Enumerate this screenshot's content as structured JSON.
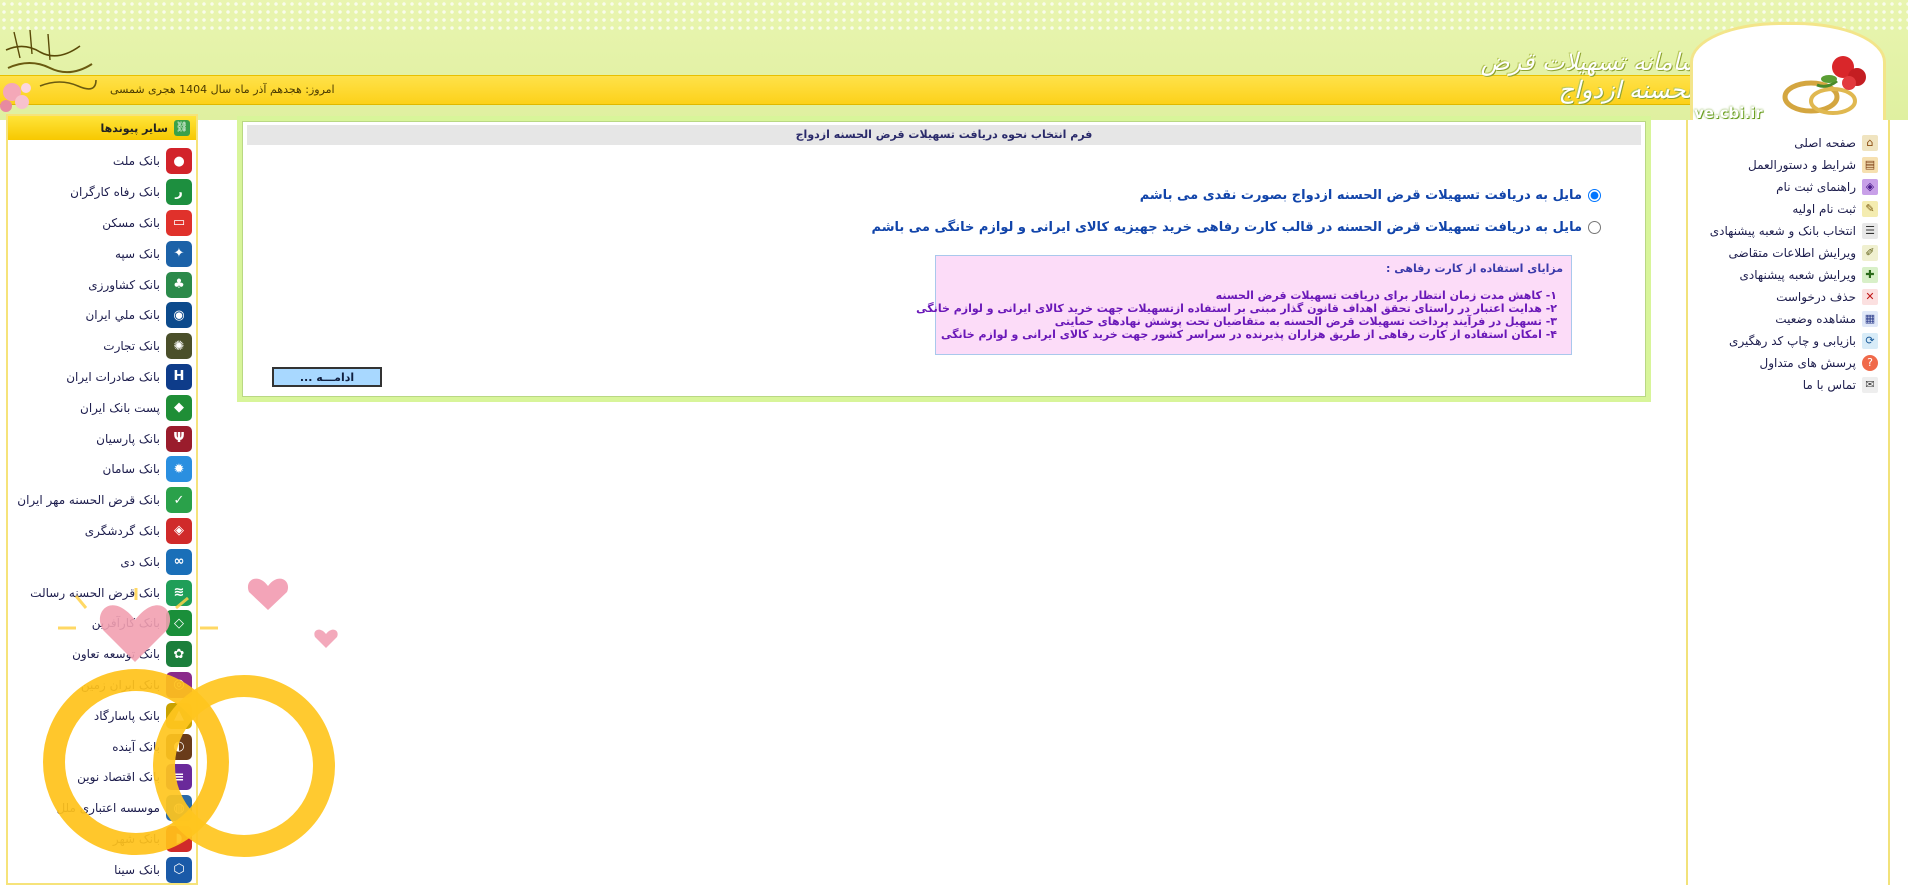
{
  "header": {
    "site_title": "سامانه تسهیلات قرض الحسنه ازدواج",
    "date_text": "امروز: هجدهم آذر ماه سال 1404 هجری شمسی",
    "logo_url_text": "ve.cbi.ir"
  },
  "right_menu": {
    "items": [
      {
        "label": "صفحه اصلی",
        "icon": "home-icon"
      },
      {
        "label": "شرایط و دستورالعمل",
        "icon": "book-icon"
      },
      {
        "label": "راهنمای ثبت نام",
        "icon": "guide-icon"
      },
      {
        "label": "ثبت نام اولیه",
        "icon": "register-icon"
      },
      {
        "label": "انتخاب بانک و شعبه پیشنهادی",
        "icon": "branch-select-icon"
      },
      {
        "label": "ویرایش اطلاعات متقاضی",
        "icon": "edit-icon"
      },
      {
        "label": "ویرایش شعبه پیشنهادی",
        "icon": "edit-branch-icon"
      },
      {
        "label": "حذف درخواست",
        "icon": "delete-icon"
      },
      {
        "label": "مشاهده وضعیت",
        "icon": "status-icon"
      },
      {
        "label": "بازیابی و چاپ کد رهگیری",
        "icon": "refresh-icon"
      },
      {
        "label": "پرسش های متداول",
        "icon": "faq-icon"
      },
      {
        "label": "تماس با ما",
        "icon": "contact-icon"
      }
    ]
  },
  "left_panel": {
    "title": "سایر پیوندها",
    "banks": [
      {
        "label": "بانک ملت",
        "color": "#d2232a",
        "glyph": "●"
      },
      {
        "label": "بانک رفاه کارگران",
        "color": "#1d8f3f",
        "glyph": "ر"
      },
      {
        "label": "بانک مسکن",
        "color": "#e0312b",
        "glyph": "▭"
      },
      {
        "label": "بانک سپه",
        "color": "#1c62a8",
        "glyph": "✦"
      },
      {
        "label": "بانک کشاورزی",
        "color": "#2b8a4a",
        "glyph": "♣"
      },
      {
        "label": "بانک ملي ايران",
        "color": "#0c4a8c",
        "glyph": "◉"
      },
      {
        "label": "بانک تجارت",
        "color": "#4a4f2a",
        "glyph": "✺"
      },
      {
        "label": "بانک صادرات ایران",
        "color": "#0e3c8a",
        "glyph": "H"
      },
      {
        "label": "پست بانک ایران",
        "color": "#1f8e36",
        "glyph": "◆"
      },
      {
        "label": "بانک پارسیان",
        "color": "#9a1c2c",
        "glyph": "Ψ"
      },
      {
        "label": "بانک سامان",
        "color": "#2a8fe0",
        "glyph": "✹"
      },
      {
        "label": "بانک قرض الحسنه مهر ایران",
        "color": "#2aa14a",
        "glyph": "✓"
      },
      {
        "label": "بانک گردشگری",
        "color": "#d02a2a",
        "glyph": "◈"
      },
      {
        "label": "بانک دی",
        "color": "#1a6fb8",
        "glyph": "∞"
      },
      {
        "label": "بانک قرض الحسنه رسالت",
        "color": "#1f9e58",
        "glyph": "≋"
      },
      {
        "label": "بانک کارآفرین",
        "color": "#1a8f3a",
        "glyph": "◇"
      },
      {
        "label": "بانک توسعه تعاون",
        "color": "#1c7f3c",
        "glyph": "✿"
      },
      {
        "label": "بانک ایران زمین",
        "color": "#8a2a8a",
        "glyph": "◎"
      },
      {
        "label": "بانک پاسارگاد",
        "color": "#c9a200",
        "glyph": "▲"
      },
      {
        "label": "بانک آینده",
        "color": "#6a3c1a",
        "glyph": "◐"
      },
      {
        "label": "بانک اقتصاد نوین",
        "color": "#6a2a9a",
        "glyph": "≡"
      },
      {
        "label": "موسسه اعتباری ملل",
        "color": "#2a6aa8",
        "glyph": "◍"
      },
      {
        "label": "بانک شهر",
        "color": "#d02a2a",
        "glyph": "◗"
      },
      {
        "label": "بانک سینا",
        "color": "#1a5aa8",
        "glyph": "⬡"
      }
    ]
  },
  "form": {
    "title": "فرم انتخاب نحوه دریافت تسهیلات قرض الحسنه ازدواج",
    "options": [
      {
        "label": "مایل به دریافت تسهیلات قرض الحسنه ازدواج بصورت نقدی می باشم",
        "selected": true
      },
      {
        "label": "مایل به دریافت تسهیلات قرض الحسنه در قالب کارت رفاهی خرید جهیزیه کالای ایرانی و لوازم خانگی می باشم",
        "selected": false
      }
    ],
    "benefits": {
      "heading": "مزایای استفاده از کارت رفاهی :",
      "items": [
        "۱- کاهش مدت زمان انتظار برای  دریافت تسهیلات قرض الحسنه",
        "۲- هدایت اعتبار در راستای تحقق اهداف قانون گذار مبنی بر استفاده ازتسهیلات جهت خرید کالای ایرانی و لوازم خانگی",
        "۳- تسهیل در فرآیند پرداخت تسهیلات قرض الحسنه به متقاضیان تحت پوشش نهادهای حمایتی",
        "۴- امکان استفاده از کارت رفاهی از طریق هزاران پذیرنده در سراسر کشور جهت خرید کالای ایرانی و لوازم خانگی"
      ]
    },
    "continue_label": "ادامـــه ..."
  }
}
